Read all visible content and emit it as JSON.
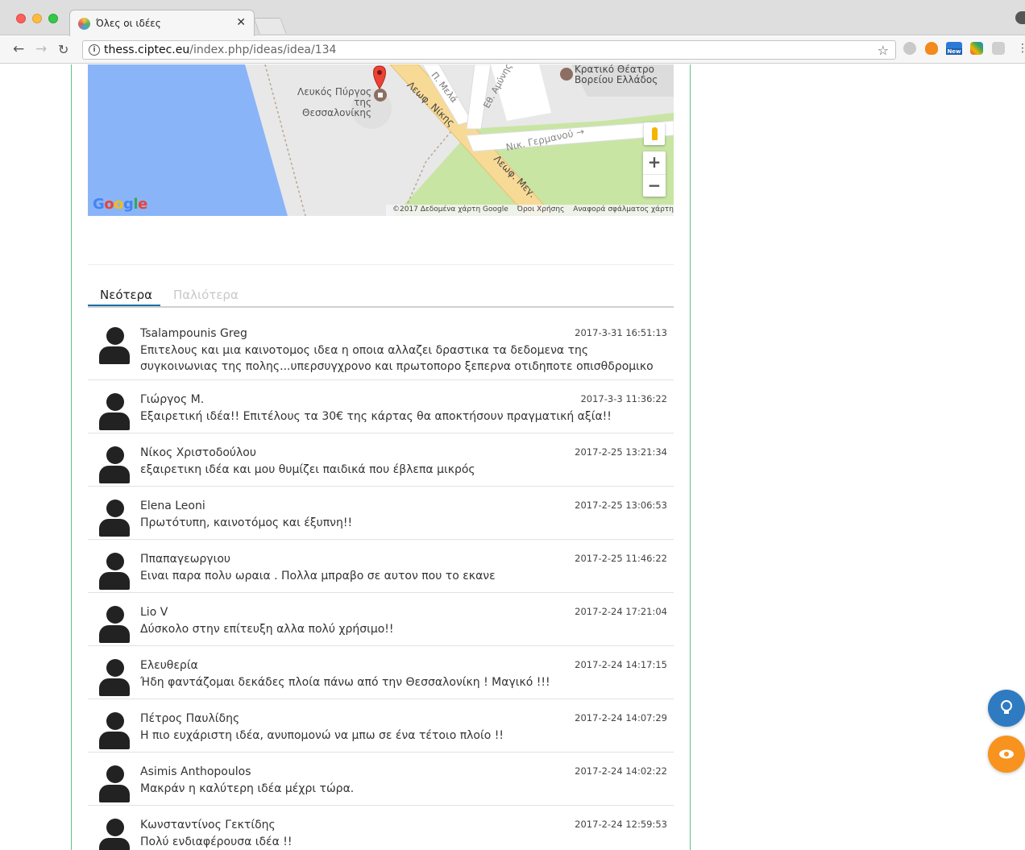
{
  "browser": {
    "tab_title": "Όλες οι ιδέες",
    "url_host": "thess.ciptec.eu",
    "url_path": "/index.php/ideas/idea/134",
    "ext3_label": "New"
  },
  "map": {
    "label_tower": "Λευκός Πύργος της Θεσσαλονίκης",
    "label_theatre_1": "Κρατικό Θέατρο",
    "label_theatre_2": "Βορείου Ελλάδος",
    "road_nikis": "Λεωφ. Νίκης",
    "road_mela": "Π. Μελά",
    "road_amyn": "Εθ. Αμύνης",
    "road_german": "Νικ. Γερμανού →",
    "road_meg": "Λεωφ. Μεγ.",
    "footer_copyright": "©2017 Δεδομένα χάρτη Google",
    "footer_terms": "Όροι Χρήσης",
    "footer_report": "Αναφορά σφάλματος χάρτη",
    "zoom_in": "+",
    "zoom_out": "−"
  },
  "tabs": {
    "newest": "Νεότερα",
    "oldest": "Παλιότερα"
  },
  "comments": [
    {
      "name": "Tsalampounis Greg",
      "date": "2017-3-31 16:51:13",
      "text": "Επιτελους και μια καινοτομος ιδεα η οποια αλλαζει δραστικα τα δεδομενα της συγκοινωνιας της πολης...υπερσυγχρονο και πρωτοπορο ξεπερνα οτιδηποτε οπισθδρομικο"
    },
    {
      "name": "Γιώργος Μ.",
      "date": "2017-3-3 11:36:22",
      "text": "Εξαιρετική ιδέα!! Επιτέλους τα 30€ της κάρτας θα αποκτήσουν πραγματική αξία!!"
    },
    {
      "name": "Νίκος Χριστοδούλου",
      "date": "2017-2-25 13:21:34",
      "text": "εξαιρετικη ιδέα και μου θυμίζει παιδικά που έβλεπα μικρός"
    },
    {
      "name": "Elena Leoni",
      "date": "2017-2-25 13:06:53",
      "text": "Πρωτότυπη, καινοτόμος και έξυπνη!!"
    },
    {
      "name": "Ππαπαγεωργιου",
      "date": "2017-2-25 11:46:22",
      "text": "Ειναι παρα πολυ ωραια . Πολλα μπραβο σε αυτον που το εκανε"
    },
    {
      "name": "Lio V",
      "date": "2017-2-24 17:21:04",
      "text": "Δύσκολο στην επίτευξη αλλα πολύ χρήσιμο!!"
    },
    {
      "name": "Ελευθερία",
      "date": "2017-2-24 14:17:15",
      "text": "Ήδη φαντάζομαι δεκάδες πλοία πάνω από την Θεσσαλονίκη ! Μαγικό !!!"
    },
    {
      "name": "Πέτρος Παυλίδης",
      "date": "2017-2-24 14:07:29",
      "text": "Η πιο ευχάριστη ιδέα, ανυπομονώ να μπω σε ένα τέτοιο πλοίο !!"
    },
    {
      "name": "Asimis Anthopoulos",
      "date": "2017-2-24 14:02:22",
      "text": "Μακράν η καλύτερη ιδέα μέχρι τώρα."
    },
    {
      "name": "Κωνσταντίνος Γεκτίδης",
      "date": "2017-2-24 12:59:53",
      "text": "Πολύ ενδιαφέρουσα ιδέα  !!"
    }
  ],
  "colors": {
    "accent": "#1d6fa8",
    "column_border": "#5fc08f",
    "fab_idea": "#2f7bc1",
    "fab_view": "#f7931e"
  },
  "icons": {
    "fab_idea": "lightbulb-icon",
    "fab_view": "eye-icon"
  }
}
